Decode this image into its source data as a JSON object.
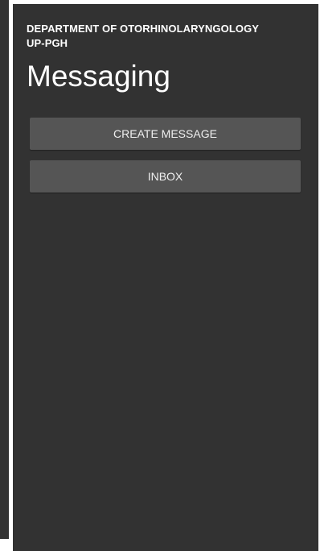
{
  "header": {
    "department_line1": "DEPARTMENT OF OTORHINOLARYNGOLOGY",
    "department_line2": "UP-PGH",
    "title": "Messaging"
  },
  "actions": {
    "create_message_label": "CREATE MESSAGE",
    "inbox_label": "INBOX"
  },
  "colors": {
    "background": "#323232",
    "button": "#555555",
    "text": "#ffffff"
  }
}
